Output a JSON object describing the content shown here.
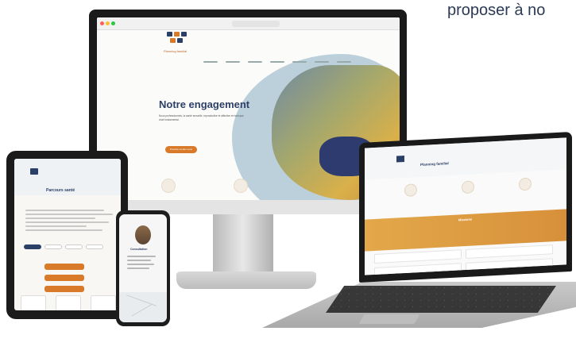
{
  "caption": "proposer à no",
  "desktop": {
    "hero_title": "Notre engagement",
    "hero_subtitle": "Nous professionnels, la santé sexuelle, reproductive et affective en tant que droit fondamental.",
    "cta_label": "Prendre rendez-vous",
    "logo_text": "Planning familial"
  },
  "tablet": {
    "title": "Parcours santé"
  },
  "phone": {
    "name": "Consultation"
  },
  "laptop": {
    "brand": "Planning familial",
    "section_title": "Missions"
  },
  "colors": {
    "navy": "#2c3f66",
    "orange": "#d97a2a",
    "sky": "#bcd0dc"
  }
}
